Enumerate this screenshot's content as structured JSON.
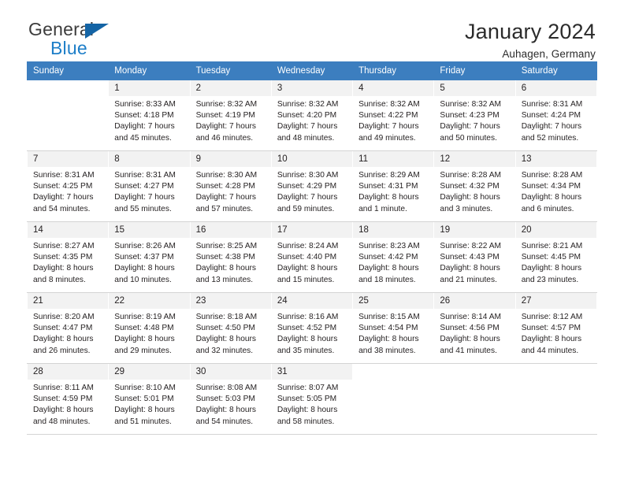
{
  "brand": {
    "word_one": "General",
    "word_two": "Blue",
    "flag_icon": "triangle-flag-icon"
  },
  "header": {
    "title": "January 2024",
    "location": "Auhagen, Germany"
  },
  "colors": {
    "header_blue": "#3c7ebf",
    "brand_blue": "#1d7ec8",
    "flag_blue": "#1464a5",
    "daynum_bg": "#f2f2f2",
    "text": "#231f20"
  },
  "weekday_headers": [
    "Sunday",
    "Monday",
    "Tuesday",
    "Wednesday",
    "Thursday",
    "Friday",
    "Saturday"
  ],
  "weeks": [
    [
      {
        "day": "",
        "lines": []
      },
      {
        "day": "1",
        "lines": [
          "Sunrise: 8:33 AM",
          "Sunset: 4:18 PM",
          "Daylight: 7 hours",
          "and 45 minutes."
        ]
      },
      {
        "day": "2",
        "lines": [
          "Sunrise: 8:32 AM",
          "Sunset: 4:19 PM",
          "Daylight: 7 hours",
          "and 46 minutes."
        ]
      },
      {
        "day": "3",
        "lines": [
          "Sunrise: 8:32 AM",
          "Sunset: 4:20 PM",
          "Daylight: 7 hours",
          "and 48 minutes."
        ]
      },
      {
        "day": "4",
        "lines": [
          "Sunrise: 8:32 AM",
          "Sunset: 4:22 PM",
          "Daylight: 7 hours",
          "and 49 minutes."
        ]
      },
      {
        "day": "5",
        "lines": [
          "Sunrise: 8:32 AM",
          "Sunset: 4:23 PM",
          "Daylight: 7 hours",
          "and 50 minutes."
        ]
      },
      {
        "day": "6",
        "lines": [
          "Sunrise: 8:31 AM",
          "Sunset: 4:24 PM",
          "Daylight: 7 hours",
          "and 52 minutes."
        ]
      }
    ],
    [
      {
        "day": "7",
        "lines": [
          "Sunrise: 8:31 AM",
          "Sunset: 4:25 PM",
          "Daylight: 7 hours",
          "and 54 minutes."
        ]
      },
      {
        "day": "8",
        "lines": [
          "Sunrise: 8:31 AM",
          "Sunset: 4:27 PM",
          "Daylight: 7 hours",
          "and 55 minutes."
        ]
      },
      {
        "day": "9",
        "lines": [
          "Sunrise: 8:30 AM",
          "Sunset: 4:28 PM",
          "Daylight: 7 hours",
          "and 57 minutes."
        ]
      },
      {
        "day": "10",
        "lines": [
          "Sunrise: 8:30 AM",
          "Sunset: 4:29 PM",
          "Daylight: 7 hours",
          "and 59 minutes."
        ]
      },
      {
        "day": "11",
        "lines": [
          "Sunrise: 8:29 AM",
          "Sunset: 4:31 PM",
          "Daylight: 8 hours",
          "and 1 minute."
        ]
      },
      {
        "day": "12",
        "lines": [
          "Sunrise: 8:28 AM",
          "Sunset: 4:32 PM",
          "Daylight: 8 hours",
          "and 3 minutes."
        ]
      },
      {
        "day": "13",
        "lines": [
          "Sunrise: 8:28 AM",
          "Sunset: 4:34 PM",
          "Daylight: 8 hours",
          "and 6 minutes."
        ]
      }
    ],
    [
      {
        "day": "14",
        "lines": [
          "Sunrise: 8:27 AM",
          "Sunset: 4:35 PM",
          "Daylight: 8 hours",
          "and 8 minutes."
        ]
      },
      {
        "day": "15",
        "lines": [
          "Sunrise: 8:26 AM",
          "Sunset: 4:37 PM",
          "Daylight: 8 hours",
          "and 10 minutes."
        ]
      },
      {
        "day": "16",
        "lines": [
          "Sunrise: 8:25 AM",
          "Sunset: 4:38 PM",
          "Daylight: 8 hours",
          "and 13 minutes."
        ]
      },
      {
        "day": "17",
        "lines": [
          "Sunrise: 8:24 AM",
          "Sunset: 4:40 PM",
          "Daylight: 8 hours",
          "and 15 minutes."
        ]
      },
      {
        "day": "18",
        "lines": [
          "Sunrise: 8:23 AM",
          "Sunset: 4:42 PM",
          "Daylight: 8 hours",
          "and 18 minutes."
        ]
      },
      {
        "day": "19",
        "lines": [
          "Sunrise: 8:22 AM",
          "Sunset: 4:43 PM",
          "Daylight: 8 hours",
          "and 21 minutes."
        ]
      },
      {
        "day": "20",
        "lines": [
          "Sunrise: 8:21 AM",
          "Sunset: 4:45 PM",
          "Daylight: 8 hours",
          "and 23 minutes."
        ]
      }
    ],
    [
      {
        "day": "21",
        "lines": [
          "Sunrise: 8:20 AM",
          "Sunset: 4:47 PM",
          "Daylight: 8 hours",
          "and 26 minutes."
        ]
      },
      {
        "day": "22",
        "lines": [
          "Sunrise: 8:19 AM",
          "Sunset: 4:48 PM",
          "Daylight: 8 hours",
          "and 29 minutes."
        ]
      },
      {
        "day": "23",
        "lines": [
          "Sunrise: 8:18 AM",
          "Sunset: 4:50 PM",
          "Daylight: 8 hours",
          "and 32 minutes."
        ]
      },
      {
        "day": "24",
        "lines": [
          "Sunrise: 8:16 AM",
          "Sunset: 4:52 PM",
          "Daylight: 8 hours",
          "and 35 minutes."
        ]
      },
      {
        "day": "25",
        "lines": [
          "Sunrise: 8:15 AM",
          "Sunset: 4:54 PM",
          "Daylight: 8 hours",
          "and 38 minutes."
        ]
      },
      {
        "day": "26",
        "lines": [
          "Sunrise: 8:14 AM",
          "Sunset: 4:56 PM",
          "Daylight: 8 hours",
          "and 41 minutes."
        ]
      },
      {
        "day": "27",
        "lines": [
          "Sunrise: 8:12 AM",
          "Sunset: 4:57 PM",
          "Daylight: 8 hours",
          "and 44 minutes."
        ]
      }
    ],
    [
      {
        "day": "28",
        "lines": [
          "Sunrise: 8:11 AM",
          "Sunset: 4:59 PM",
          "Daylight: 8 hours",
          "and 48 minutes."
        ]
      },
      {
        "day": "29",
        "lines": [
          "Sunrise: 8:10 AM",
          "Sunset: 5:01 PM",
          "Daylight: 8 hours",
          "and 51 minutes."
        ]
      },
      {
        "day": "30",
        "lines": [
          "Sunrise: 8:08 AM",
          "Sunset: 5:03 PM",
          "Daylight: 8 hours",
          "and 54 minutes."
        ]
      },
      {
        "day": "31",
        "lines": [
          "Sunrise: 8:07 AM",
          "Sunset: 5:05 PM",
          "Daylight: 8 hours",
          "and 58 minutes."
        ]
      },
      {
        "day": "",
        "lines": []
      },
      {
        "day": "",
        "lines": []
      },
      {
        "day": "",
        "lines": []
      }
    ]
  ]
}
